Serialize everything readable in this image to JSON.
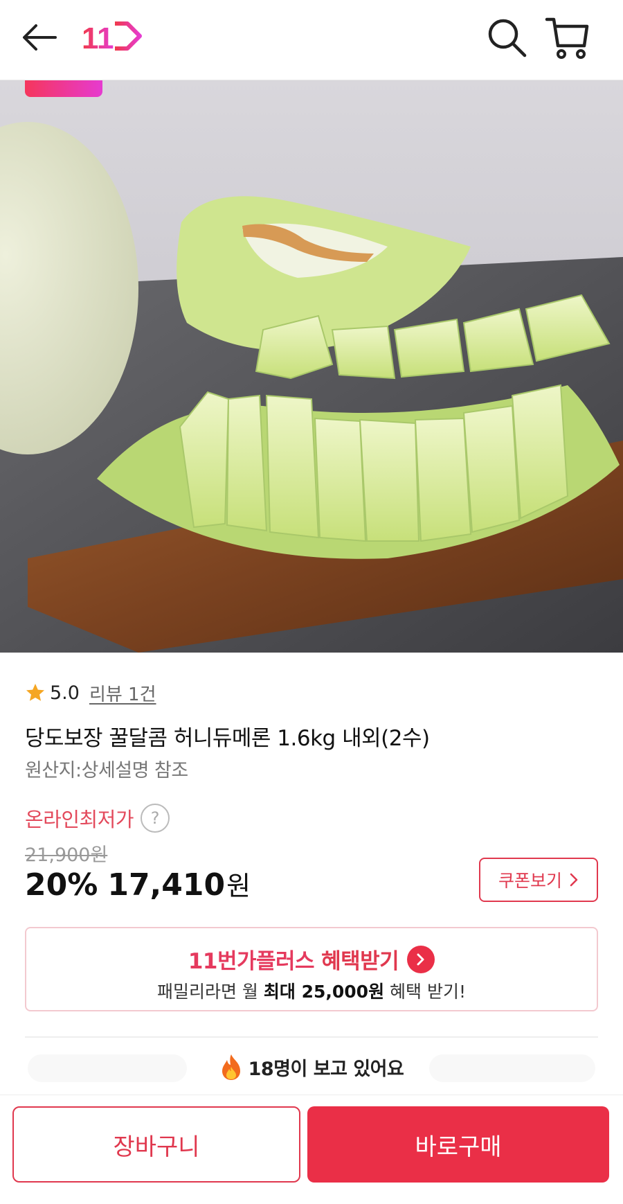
{
  "header": {
    "back_icon": "arrow-left-icon",
    "logo_text": "11",
    "search_icon": "search-icon",
    "cart_icon": "cart-icon"
  },
  "product": {
    "rating": "5.0",
    "review_link": "리뷰 1건",
    "title": "당도보장 꿀달콤 허니듀메론 1.6kg 내외(2수)",
    "origin": "원산지:상세설명 참조"
  },
  "price": {
    "label": "온라인최저가",
    "help": "?",
    "original": "21,900원",
    "discount": "20%",
    "sale": "17,410",
    "currency": "원",
    "coupon_button": "쿠폰보기"
  },
  "plus_banner": {
    "brand": "11번가플러스",
    "action": "혜택받기",
    "line2_prefix": "패밀리라면 월 ",
    "line2_bold": "최대 25,000원",
    "line2_suffix": " 혜택 받기!"
  },
  "viewing": {
    "text": "18명이 보고 있어요"
  },
  "bottom_bar": {
    "cart_button": "장바구니",
    "buy_button": "바로구매"
  },
  "colors": {
    "accent": "#ea2f47",
    "price_label": "#e34a5c",
    "plus_brand": "#e53a5e"
  }
}
